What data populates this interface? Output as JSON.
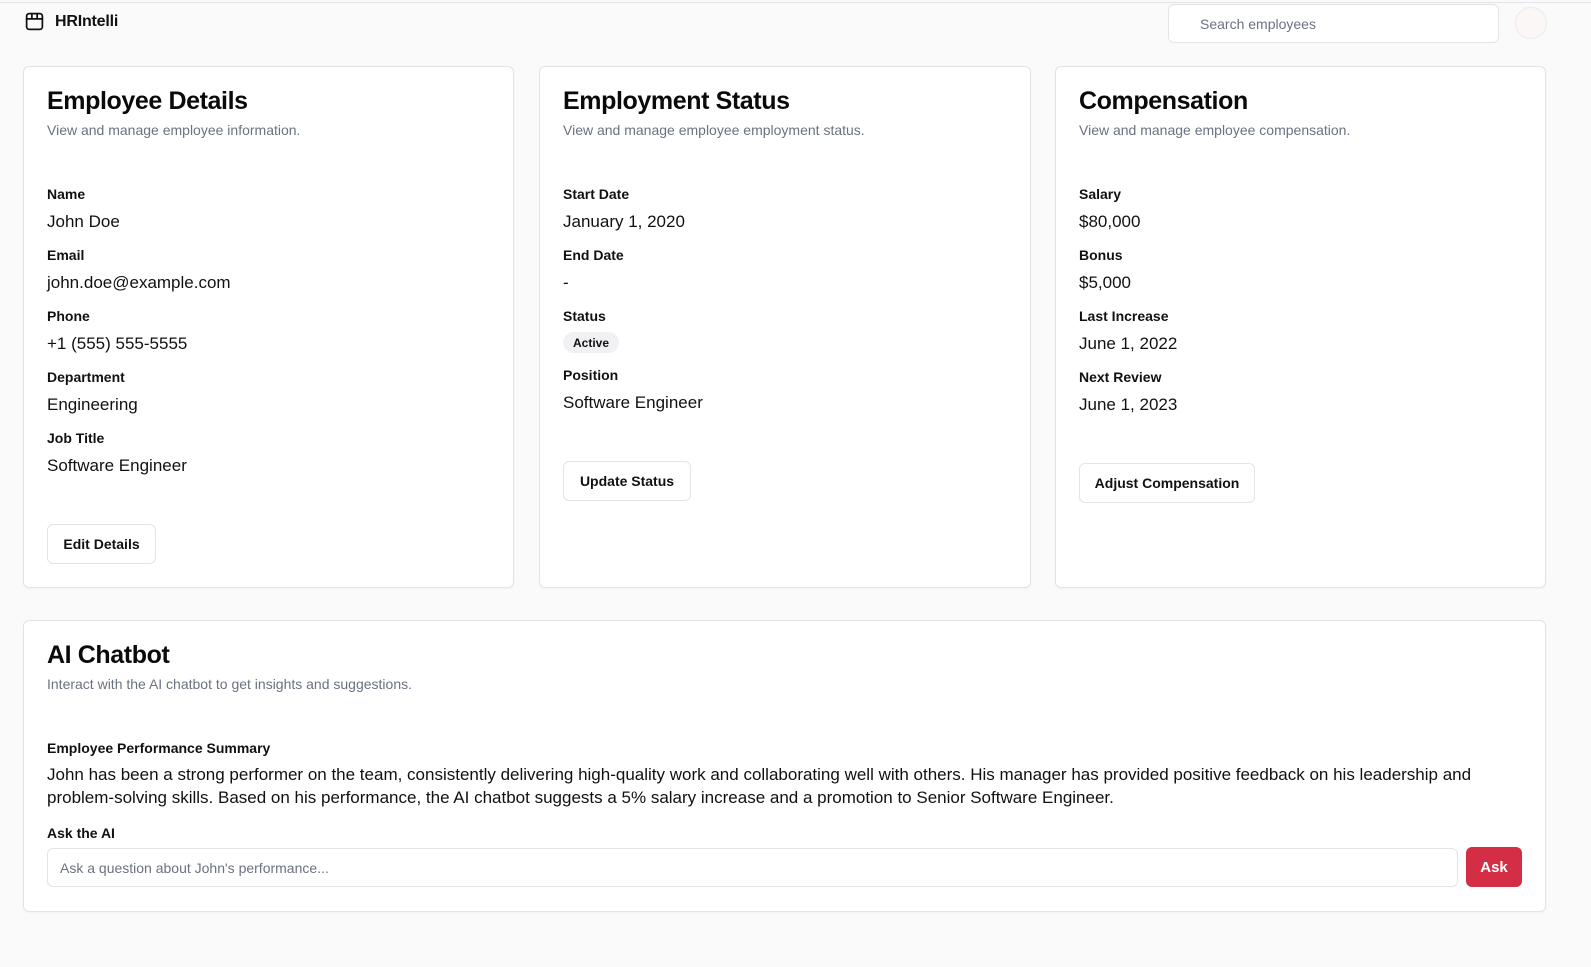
{
  "app": {
    "name": "HRIntelli",
    "logo_icon": "browser-window-icon"
  },
  "header": {
    "search_placeholder": "Search employees"
  },
  "employee_details": {
    "title": "Employee Details",
    "subtitle": "View and manage employee information.",
    "fields": [
      {
        "label": "Name",
        "value": "John Doe"
      },
      {
        "label": "Email",
        "value": "john.doe@example.com"
      },
      {
        "label": "Phone",
        "value": "+1 (555) 555-5555"
      },
      {
        "label": "Department",
        "value": "Engineering"
      },
      {
        "label": "Job Title",
        "value": "Software Engineer"
      }
    ],
    "button": "Edit Details"
  },
  "employment_status": {
    "title": "Employment Status",
    "subtitle": "View and manage employee employment status.",
    "start_date_label": "Start Date",
    "start_date": "January 1, 2020",
    "end_date_label": "End Date",
    "end_date": "-",
    "status_label": "Status",
    "status": "Active",
    "position_label": "Position",
    "position": "Software Engineer",
    "button": "Update Status"
  },
  "compensation": {
    "title": "Compensation",
    "subtitle": "View and manage employee compensation.",
    "fields": [
      {
        "label": "Salary",
        "value": "$80,000"
      },
      {
        "label": "Bonus",
        "value": "$5,000"
      },
      {
        "label": "Last Increase",
        "value": "June 1, 2022"
      },
      {
        "label": "Next Review",
        "value": "June 1, 2023"
      }
    ],
    "button": "Adjust Compensation"
  },
  "chatbot": {
    "title": "AI Chatbot",
    "subtitle": "Interact with the AI chatbot to get insights and suggestions.",
    "summary_label": "Employee Performance Summary",
    "summary": "John has been a strong performer on the team, consistently delivering high-quality work and collaborating well with others. His manager has provided positive feedback on his leadership and problem-solving skills. Based on his performance, the AI chatbot suggests a 5% salary increase and a promotion to Senior Software Engineer.",
    "ask_label": "Ask the AI",
    "input_placeholder": "Ask a question about John's performance...",
    "ask_button": "Ask"
  },
  "colors": {
    "accent": "#d42e46",
    "background": "#fafafa",
    "border": "#e4e4e7",
    "muted_text": "#6b7280"
  }
}
